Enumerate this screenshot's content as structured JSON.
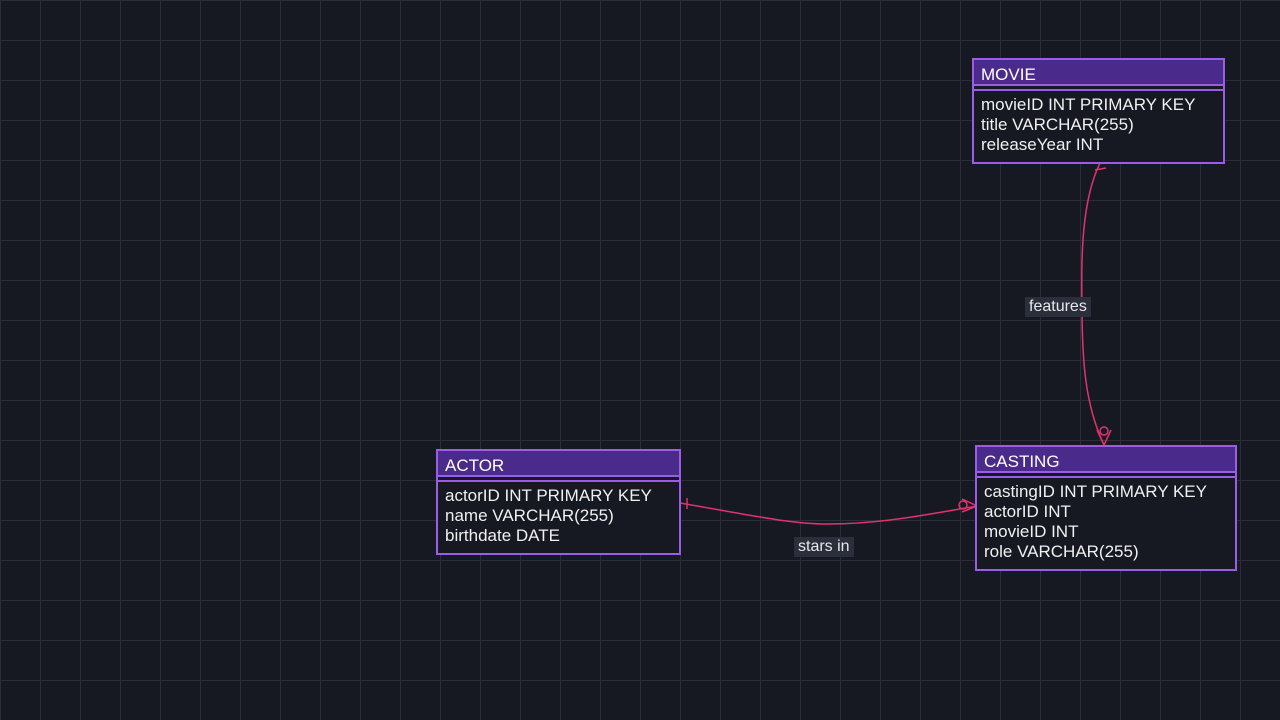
{
  "colors": {
    "background": "#161922",
    "grid": "#2a2e38",
    "entity_border": "#9b5de5",
    "entity_header": "#4a2b8c",
    "relationship": "#e0336e",
    "label_bg": "#2b2f3b"
  },
  "entities": {
    "movie": {
      "name": "MOVIE",
      "attributes": [
        "movieID INT PRIMARY KEY",
        "title VARCHAR(255)",
        "releaseYear INT"
      ]
    },
    "actor": {
      "name": "ACTOR",
      "attributes": [
        "actorID INT PRIMARY KEY",
        "name VARCHAR(255)",
        "birthdate DATE"
      ]
    },
    "casting": {
      "name": "CASTING",
      "attributes": [
        "castingID INT PRIMARY KEY",
        "actorID INT",
        "movieID INT",
        "role VARCHAR(255)"
      ]
    }
  },
  "relationships": {
    "features": {
      "label": "features",
      "from": "MOVIE",
      "to": "CASTING",
      "from_cardinality": "one",
      "to_cardinality": "zero-or-many"
    },
    "stars_in": {
      "label": "stars in",
      "from": "ACTOR",
      "to": "CASTING",
      "from_cardinality": "one",
      "to_cardinality": "zero-or-many"
    }
  }
}
